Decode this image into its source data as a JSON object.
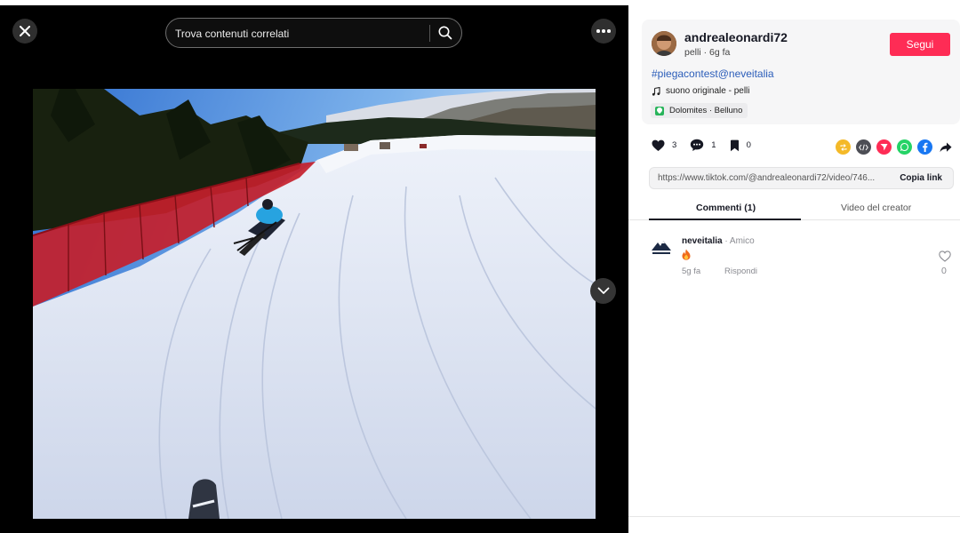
{
  "search": {
    "placeholder": "Trova contenuti correlati"
  },
  "post": {
    "username": "andrealeonardi72",
    "author_name": "pelli",
    "posted_ago": "6g fa",
    "meta_line": "pelli · 6g fa",
    "follow_label": "Segui",
    "hashtags": "#piegacontest@neveitalia",
    "music": "suono originale - pelli",
    "location": "Dolomites · Belluno",
    "likes": "3",
    "comments": "1",
    "saves": "0",
    "link": "https://www.tiktok.com/@andrealeonardi72/video/746...",
    "copy_label": "Copia link"
  },
  "tabs": [
    {
      "label": "Commenti (1)",
      "active": true
    },
    {
      "label": "Video del creator",
      "active": false
    }
  ],
  "comments": [
    {
      "author": "neveitalia",
      "relation": " · Amico",
      "text_emoji": "fire",
      "time": "5g fa",
      "reply_label": "Rispondi",
      "likes": "0"
    }
  ],
  "share_icons": [
    "repost-icon",
    "embed-icon",
    "direct-message-icon",
    "whatsapp-icon",
    "facebook-icon",
    "share-arrow-icon"
  ],
  "colors": {
    "follow": "#fe2c55",
    "hashtag": "#2b5db9",
    "location_pin": "#28b45b"
  }
}
